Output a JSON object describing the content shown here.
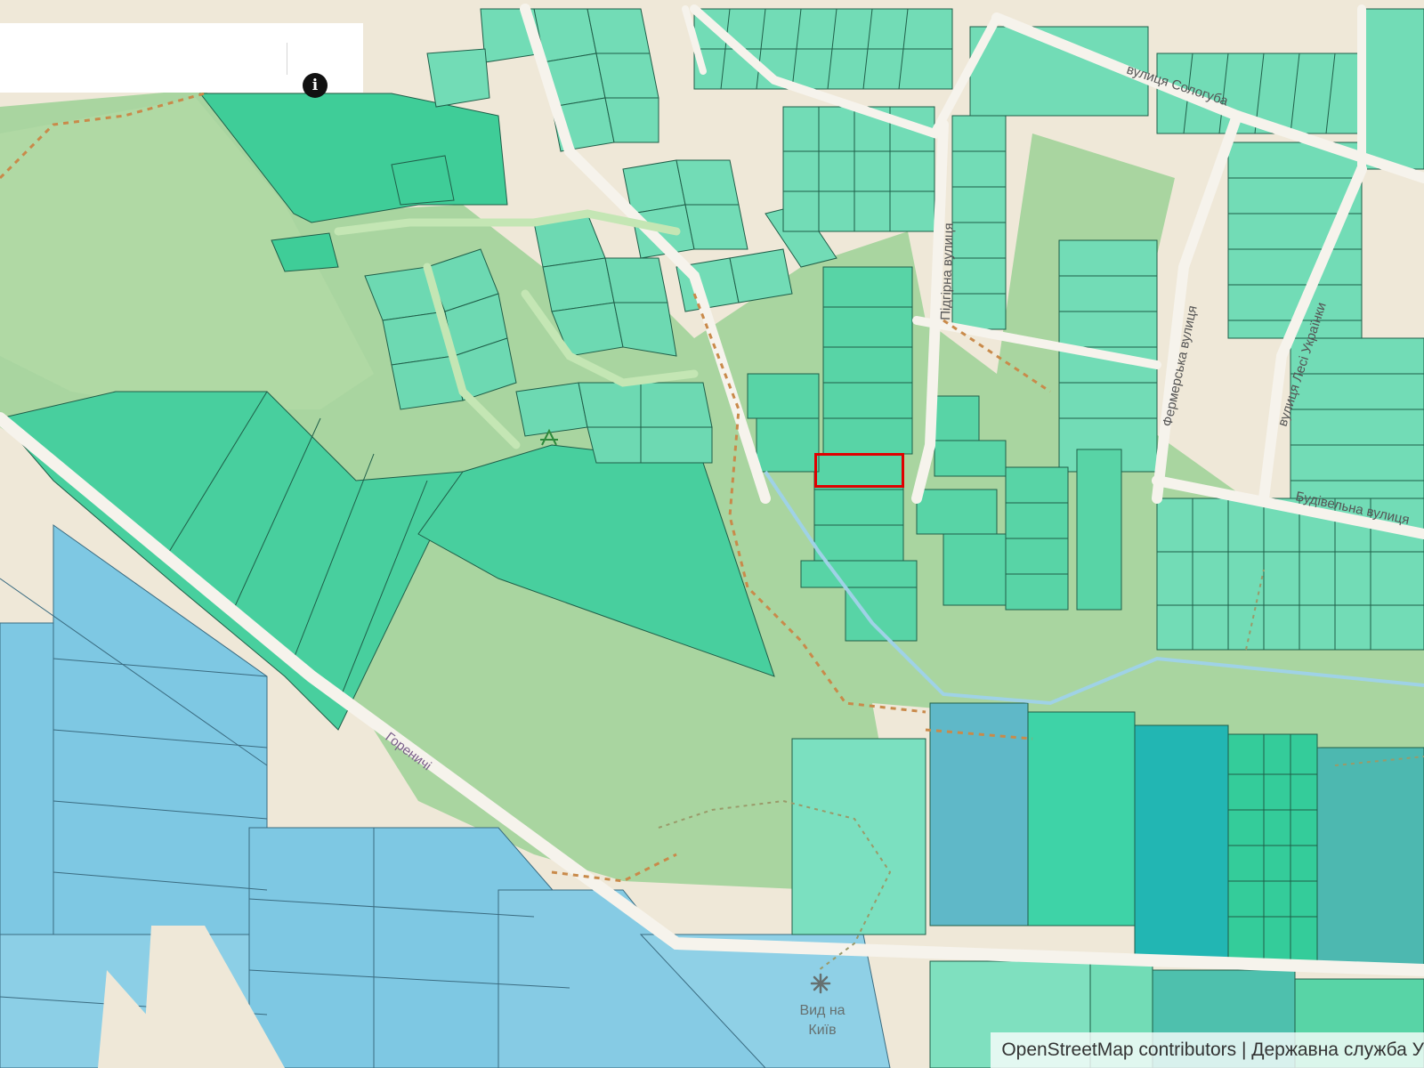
{
  "search": {
    "placeholder": "",
    "value": ""
  },
  "info_button": {
    "icon": "info-icon",
    "glyph": "i"
  },
  "street_labels": [
    "вулиця Сологуба",
    "Підгірна вулиця",
    "Фермерська вулиця",
    "вулиця Лесі Українки",
    "Будівельна вулиця",
    "Гореничі"
  ],
  "poi": {
    "viewpoint_label_line1": "Вид на",
    "viewpoint_label_line2": "Київ",
    "viewpoint_icon": "viewpoint-icon",
    "shelter_icon": "shelter-icon"
  },
  "attribution": {
    "osm": "OpenStreetMap contributors",
    "separator": " | ",
    "cadastre": "Державна служба У"
  },
  "selected_parcel": {
    "highlight_color": "#e00000"
  },
  "colors": {
    "land_base": "#efe8d8",
    "forest": "#a9d5a0",
    "parcel_light": "#7fe0bf",
    "parcel_mid": "#52d3a2",
    "parcel_dark": "#2fbf90",
    "parcel_teal": "#1fb3b0",
    "parcel_blue": "#7ec8e3",
    "road": "#f6f3ec",
    "path": "#c98a4a",
    "stream": "#9fd2e6",
    "label_road": "#555555",
    "label_place": "#7a5f8a"
  }
}
